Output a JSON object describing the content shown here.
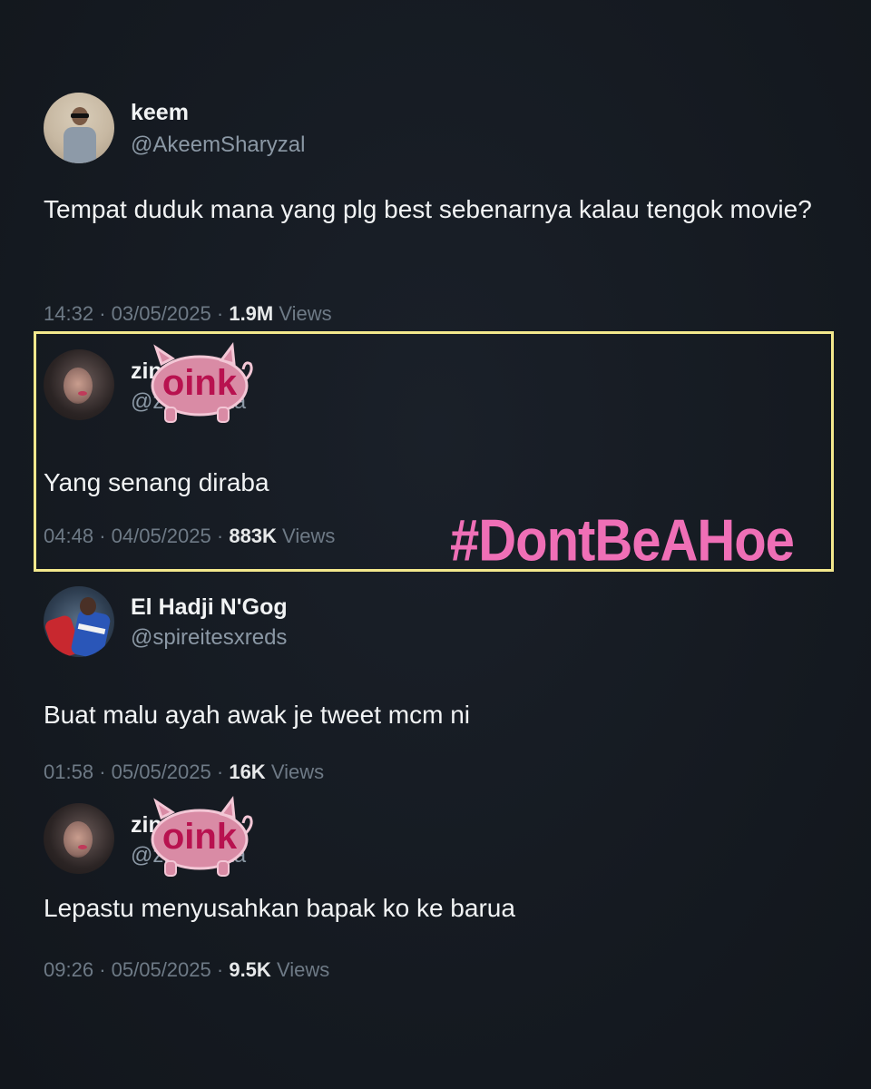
{
  "tweets": [
    {
      "name": "keem",
      "handle": "@AkeemSharyzal",
      "text": "Tempat duduk mana yang plg best sebenarnya kalau tengok movie?",
      "time": "14:32",
      "date": "03/05/2025",
      "views_count": "1.9M",
      "views_label": "Views"
    },
    {
      "name": "zinnia",
      "handle": "@zinnniaaa",
      "text": "Yang senang diraba",
      "time": "04:48",
      "date": "04/05/2025",
      "views_count": "883K",
      "views_label": "Views"
    },
    {
      "name": "El Hadji N'Gog",
      "handle": "@spireitesxreds",
      "text": "Buat malu ayah awak je tweet mcm ni",
      "time": "01:58",
      "date": "05/05/2025",
      "views_count": "16K",
      "views_label": "Views"
    },
    {
      "name": "zinnia",
      "handle": "@zinnniaaa",
      "text": "Lepastu menyusahkan bapak ko ke barua",
      "time": "09:26",
      "date": "05/05/2025",
      "views_count": "9.5K",
      "views_label": "Views"
    }
  ],
  "overlay": {
    "hashtag": "#DontBeAHoe",
    "sticker_text": "oink",
    "highlight_color": "#f3e88c",
    "hashtag_color": "#ef6fb6"
  },
  "separator": "·"
}
